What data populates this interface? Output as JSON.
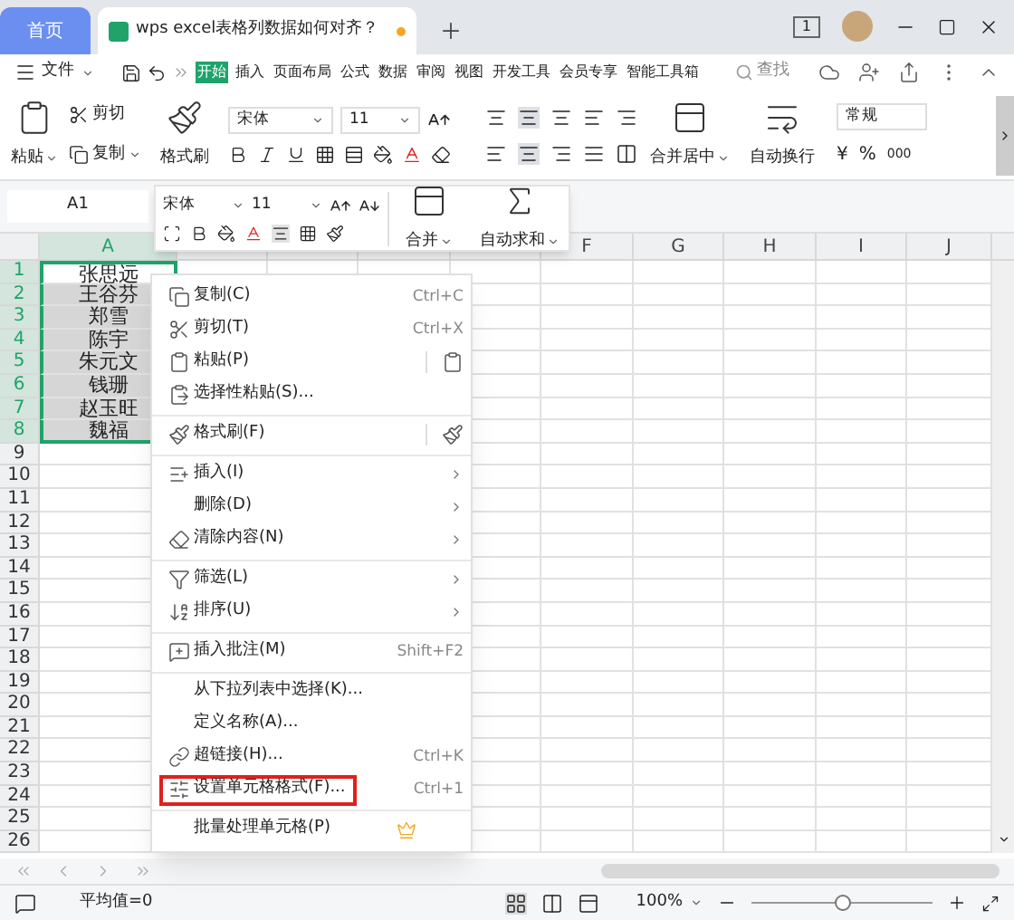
{
  "window_tabs": [
    {
      "kind": "home",
      "label": "首页",
      "selected": false
    },
    {
      "kind": "document",
      "label": "wps excel表格列数据如何对齐？",
      "selected": true,
      "unsaved": true
    }
  ],
  "title_bar": {
    "badge": "1"
  },
  "menu_bar": {
    "file": "文件",
    "tabs": [
      {
        "label": "开始",
        "selected": true
      },
      {
        "label": "插入",
        "selected": false
      },
      {
        "label": "页面布局",
        "selected": false
      },
      {
        "label": "公式",
        "selected": false
      },
      {
        "label": "数据",
        "selected": false
      },
      {
        "label": "审阅",
        "selected": false
      },
      {
        "label": "视图",
        "selected": false
      },
      {
        "label": "开发工具",
        "selected": false
      },
      {
        "label": "会员专享",
        "selected": false
      },
      {
        "label": "智能工具箱",
        "selected": false
      }
    ],
    "search": {
      "placeholder": "查找"
    }
  },
  "ribbon": {
    "paste": "粘贴",
    "cut": "剪切",
    "copy": "复制",
    "format_painter": "格式刷",
    "font": "宋体",
    "font_size": "11",
    "merge": "合并居中",
    "wrap": "自动换行",
    "number_format": "常规",
    "currency": "¥",
    "percent": "%",
    "thousands": "000"
  },
  "name_box": "A1",
  "mini_toolbar": {
    "font": "宋体",
    "font_size": "11",
    "merge": "合并",
    "autosum": "自动求和"
  },
  "sheet": {
    "columns": [
      {
        "label": "A",
        "selected": true
      },
      {
        "label": "F",
        "selected": false
      },
      {
        "label": "G",
        "selected": false
      },
      {
        "label": "H",
        "selected": false
      },
      {
        "label": "I",
        "selected": false
      },
      {
        "label": "J",
        "selected": false
      }
    ],
    "rows": [
      {
        "number": "1",
        "value": "张思远",
        "selected": true
      },
      {
        "number": "2",
        "value": "王谷芬",
        "selected": true
      },
      {
        "number": "3",
        "value": "郑雪",
        "selected": true
      },
      {
        "number": "4",
        "value": "陈宇",
        "selected": true
      },
      {
        "number": "5",
        "value": "朱元文",
        "selected": true
      },
      {
        "number": "6",
        "value": "钱珊",
        "selected": true
      },
      {
        "number": "7",
        "value": "赵玉旺",
        "selected": true
      },
      {
        "number": "8",
        "value": "魏福",
        "selected": true
      },
      {
        "number": "9",
        "selected": false
      },
      {
        "number": "10",
        "selected": false
      },
      {
        "number": "11",
        "selected": false
      },
      {
        "number": "12",
        "selected": false
      },
      {
        "number": "13",
        "selected": false
      },
      {
        "number": "14",
        "selected": false
      },
      {
        "number": "15",
        "selected": false
      },
      {
        "number": "16",
        "selected": false
      },
      {
        "number": "17",
        "selected": false
      },
      {
        "number": "18",
        "selected": false
      },
      {
        "number": "19",
        "selected": false
      },
      {
        "number": "20",
        "selected": false
      },
      {
        "number": "21",
        "selected": false
      },
      {
        "number": "22",
        "selected": false
      },
      {
        "number": "23",
        "selected": false
      },
      {
        "number": "24",
        "selected": false
      },
      {
        "number": "25",
        "selected": false
      },
      {
        "number": "26",
        "selected": false
      }
    ]
  },
  "context_menu": [
    [
      {
        "label": "复制(C)",
        "shortcut": "Ctrl+C",
        "submenu": false,
        "outlined": false
      },
      {
        "label": "剪切(T)",
        "shortcut": "Ctrl+X",
        "submenu": false,
        "outlined": false
      },
      {
        "label": "粘贴(P)",
        "submenu": false,
        "outlined": false
      },
      {
        "label": "选择性粘贴(S)...",
        "submenu": false,
        "outlined": false
      }
    ],
    [
      {
        "label": "格式刷(F)",
        "submenu": false,
        "outlined": false
      }
    ],
    [
      {
        "label": "插入(I)",
        "submenu": true,
        "outlined": false
      },
      {
        "label": "删除(D)",
        "submenu": true,
        "outlined": false
      },
      {
        "label": "清除内容(N)",
        "submenu": true,
        "outlined": false
      }
    ],
    [
      {
        "label": "筛选(L)",
        "submenu": true,
        "outlined": false
      },
      {
        "label": "排序(U)",
        "submenu": true,
        "outlined": false
      }
    ],
    [
      {
        "label": "插入批注(M)",
        "shortcut": "Shift+F2",
        "submenu": false,
        "outlined": false
      }
    ],
    [
      {
        "label": "从下拉列表中选择(K)...",
        "submenu": false,
        "outlined": false
      },
      {
        "label": "定义名称(A)...",
        "submenu": false,
        "outlined": false
      },
      {
        "label": "超链接(H)...",
        "shortcut": "Ctrl+K",
        "submenu": false,
        "outlined": false
      },
      {
        "label": "设置单元格格式(F)...",
        "shortcut": "Ctrl+1",
        "submenu": false,
        "outlined": true
      }
    ],
    [
      {
        "label": "批量处理单元格(P)",
        "submenu": false,
        "outlined": false
      }
    ]
  ],
  "status_bar": {
    "average": "平均值=0",
    "zoom": "100%",
    "zoom_slider": {
      "level": 0.5
    }
  }
}
